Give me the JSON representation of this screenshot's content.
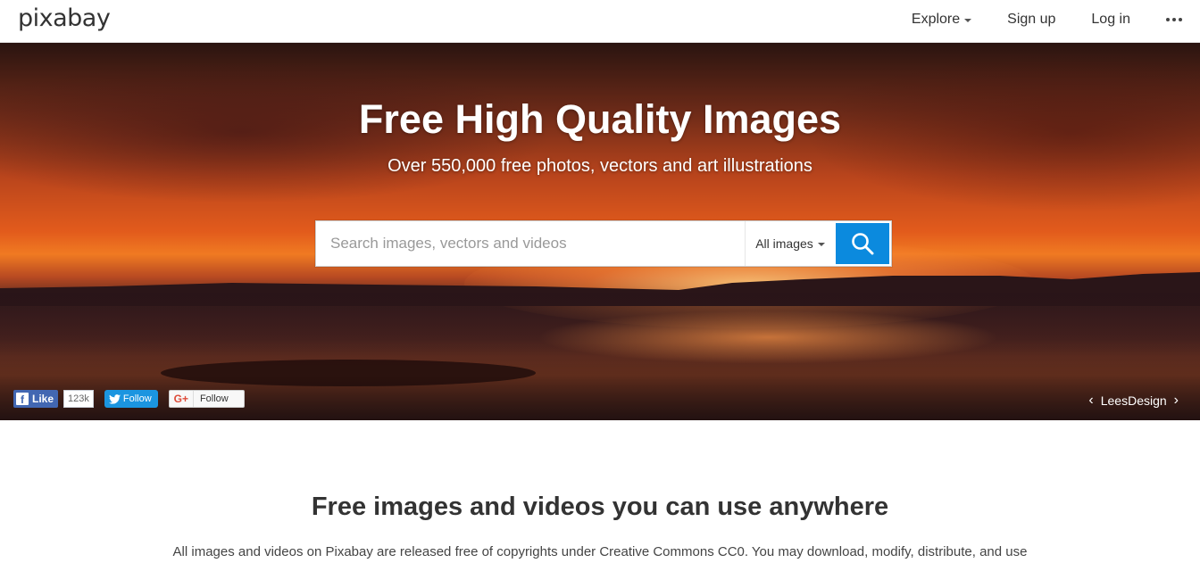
{
  "header": {
    "logo": "pixabay",
    "nav": {
      "explore": "Explore",
      "signup": "Sign up",
      "login": "Log in"
    },
    "more_icon": "more-dots-icon"
  },
  "hero": {
    "title": "Free High Quality Images",
    "subtitle": "Over 550,000 free photos, vectors and art illustrations",
    "search": {
      "placeholder": "Search images, vectors and videos",
      "value": "",
      "type_selected": "All images",
      "button_icon": "search-icon"
    },
    "social": {
      "facebook_label": "Like",
      "facebook_count": "123k",
      "twitter_label": "Follow",
      "google_label": "Follow"
    },
    "credit": "LeesDesign"
  },
  "intro": {
    "title": "Free images and videos you can use anywhere",
    "text": "All images and videos on Pixabay are released free of copyrights under Creative Commons CC0. You may download, modify, distribute, and use"
  },
  "colors": {
    "accent": "#0b8ade",
    "facebook": "#4267b2",
    "twitter": "#1b95e0"
  }
}
